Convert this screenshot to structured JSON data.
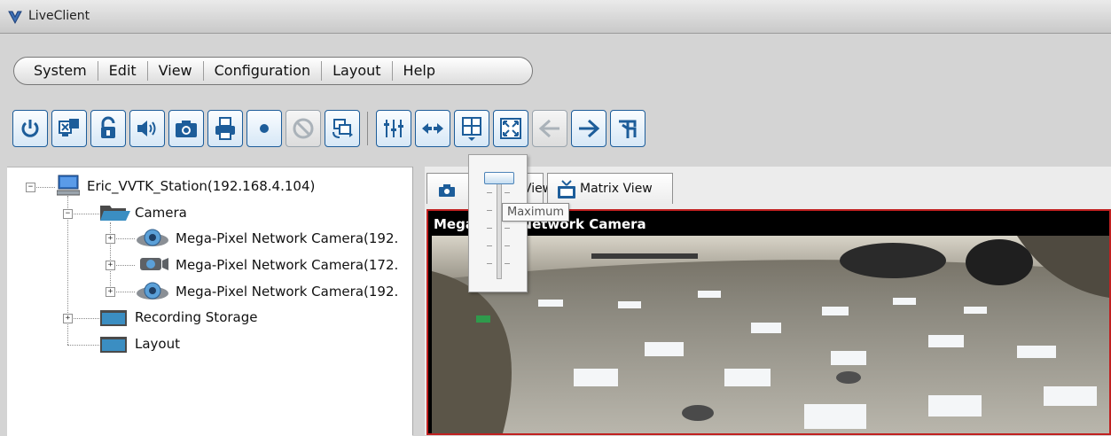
{
  "window": {
    "title": "LiveClient"
  },
  "menu": {
    "items": [
      "System",
      "Edit",
      "View",
      "Configuration",
      "Layout",
      "Help"
    ]
  },
  "toolbar": {
    "buttons": [
      {
        "icon": "power-icon"
      },
      {
        "icon": "monitor-grid-icon"
      },
      {
        "icon": "padlock-icon"
      },
      {
        "icon": "speaker-icon"
      },
      {
        "icon": "camera-icon"
      },
      {
        "icon": "printer-icon"
      },
      {
        "icon": "record-dot-icon"
      },
      {
        "icon": "disabled-circle-icon"
      },
      {
        "icon": "refresh-screens-icon"
      },
      {
        "icon": "volume-slider-icon"
      },
      {
        "icon": "swap-arrows-icon"
      },
      {
        "icon": "layout-grid-dropdown-icon"
      },
      {
        "icon": "fullscreen-icon"
      },
      {
        "icon": "arrow-left-icon"
      },
      {
        "icon": "arrow-right-icon"
      },
      {
        "icon": "pin-icon"
      }
    ]
  },
  "tree": {
    "station": "Eric_VVTK_Station(192.168.4.104)",
    "camera_group": "Camera",
    "cameras": [
      "Mega-Pixel Network Camera(192.",
      "Mega-Pixel Network Camera(172.",
      "Mega-Pixel Network Camera(192."
    ],
    "recording_storage": "Recording Storage",
    "layout": "Layout"
  },
  "tabs": {
    "single_view": "View",
    "matrix_view": "Matrix View"
  },
  "video": {
    "title": "Mega-Pixel Network Camera"
  },
  "slider": {
    "tooltip": "Maximum",
    "level": 1.0
  },
  "colors": {
    "toolbar_blue": "#1d5d9a",
    "active_frame": "#c02020"
  }
}
